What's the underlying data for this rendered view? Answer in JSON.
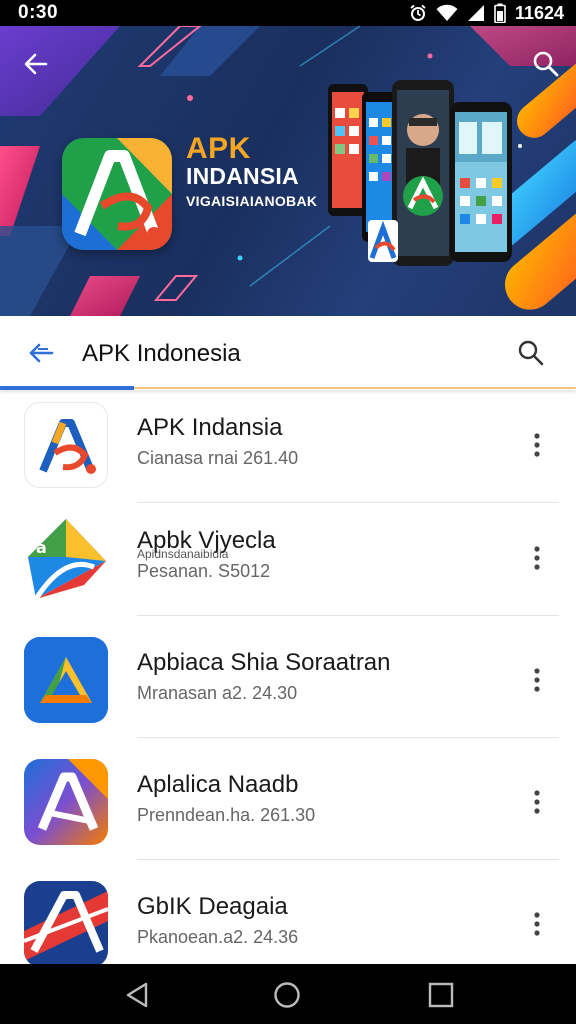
{
  "status_bar": {
    "time": "0:30",
    "right_text": "11624",
    "icons": [
      "alarm-icon",
      "wifi-icon",
      "cell-signal-icon",
      "battery-icon"
    ]
  },
  "hero": {
    "brand_line1": "APK",
    "brand_line2": "INDANSIA",
    "brand_line3": "VIGAISIAIANOBAK",
    "icons": [
      "back-arrow-icon",
      "search-icon"
    ]
  },
  "search_bar": {
    "title": "APK Indonesia",
    "icons": [
      "back-arrow-icon",
      "search-icon"
    ],
    "accent": "#2f6fd8"
  },
  "apps": [
    {
      "name": "APK Indansia",
      "subtitle": "Cianasa rnai 261.40",
      "extra": ""
    },
    {
      "name": "Apbk Vjyecla",
      "subtitle": "Pesanan. S5012",
      "extra": "Apidnsdanaibidia"
    },
    {
      "name": "Apbiaca Shia Soraatran",
      "subtitle": "Mranasan a2. 24.30",
      "extra": ""
    },
    {
      "name": "Aplalica Naadb",
      "subtitle": "Prenndean.ha. 261.30",
      "extra": ""
    },
    {
      "name": "GbIK Deagaia",
      "subtitle": "Pkanoean.a2. 24.36",
      "extra": ""
    }
  ],
  "nav_bar": {
    "icons": [
      "nav-back-icon",
      "nav-home-icon",
      "nav-recents-icon"
    ]
  },
  "colors": {
    "hero_bg": "#1f3b73",
    "brand_orange": "#f5a623",
    "status_bar": "#000000"
  }
}
